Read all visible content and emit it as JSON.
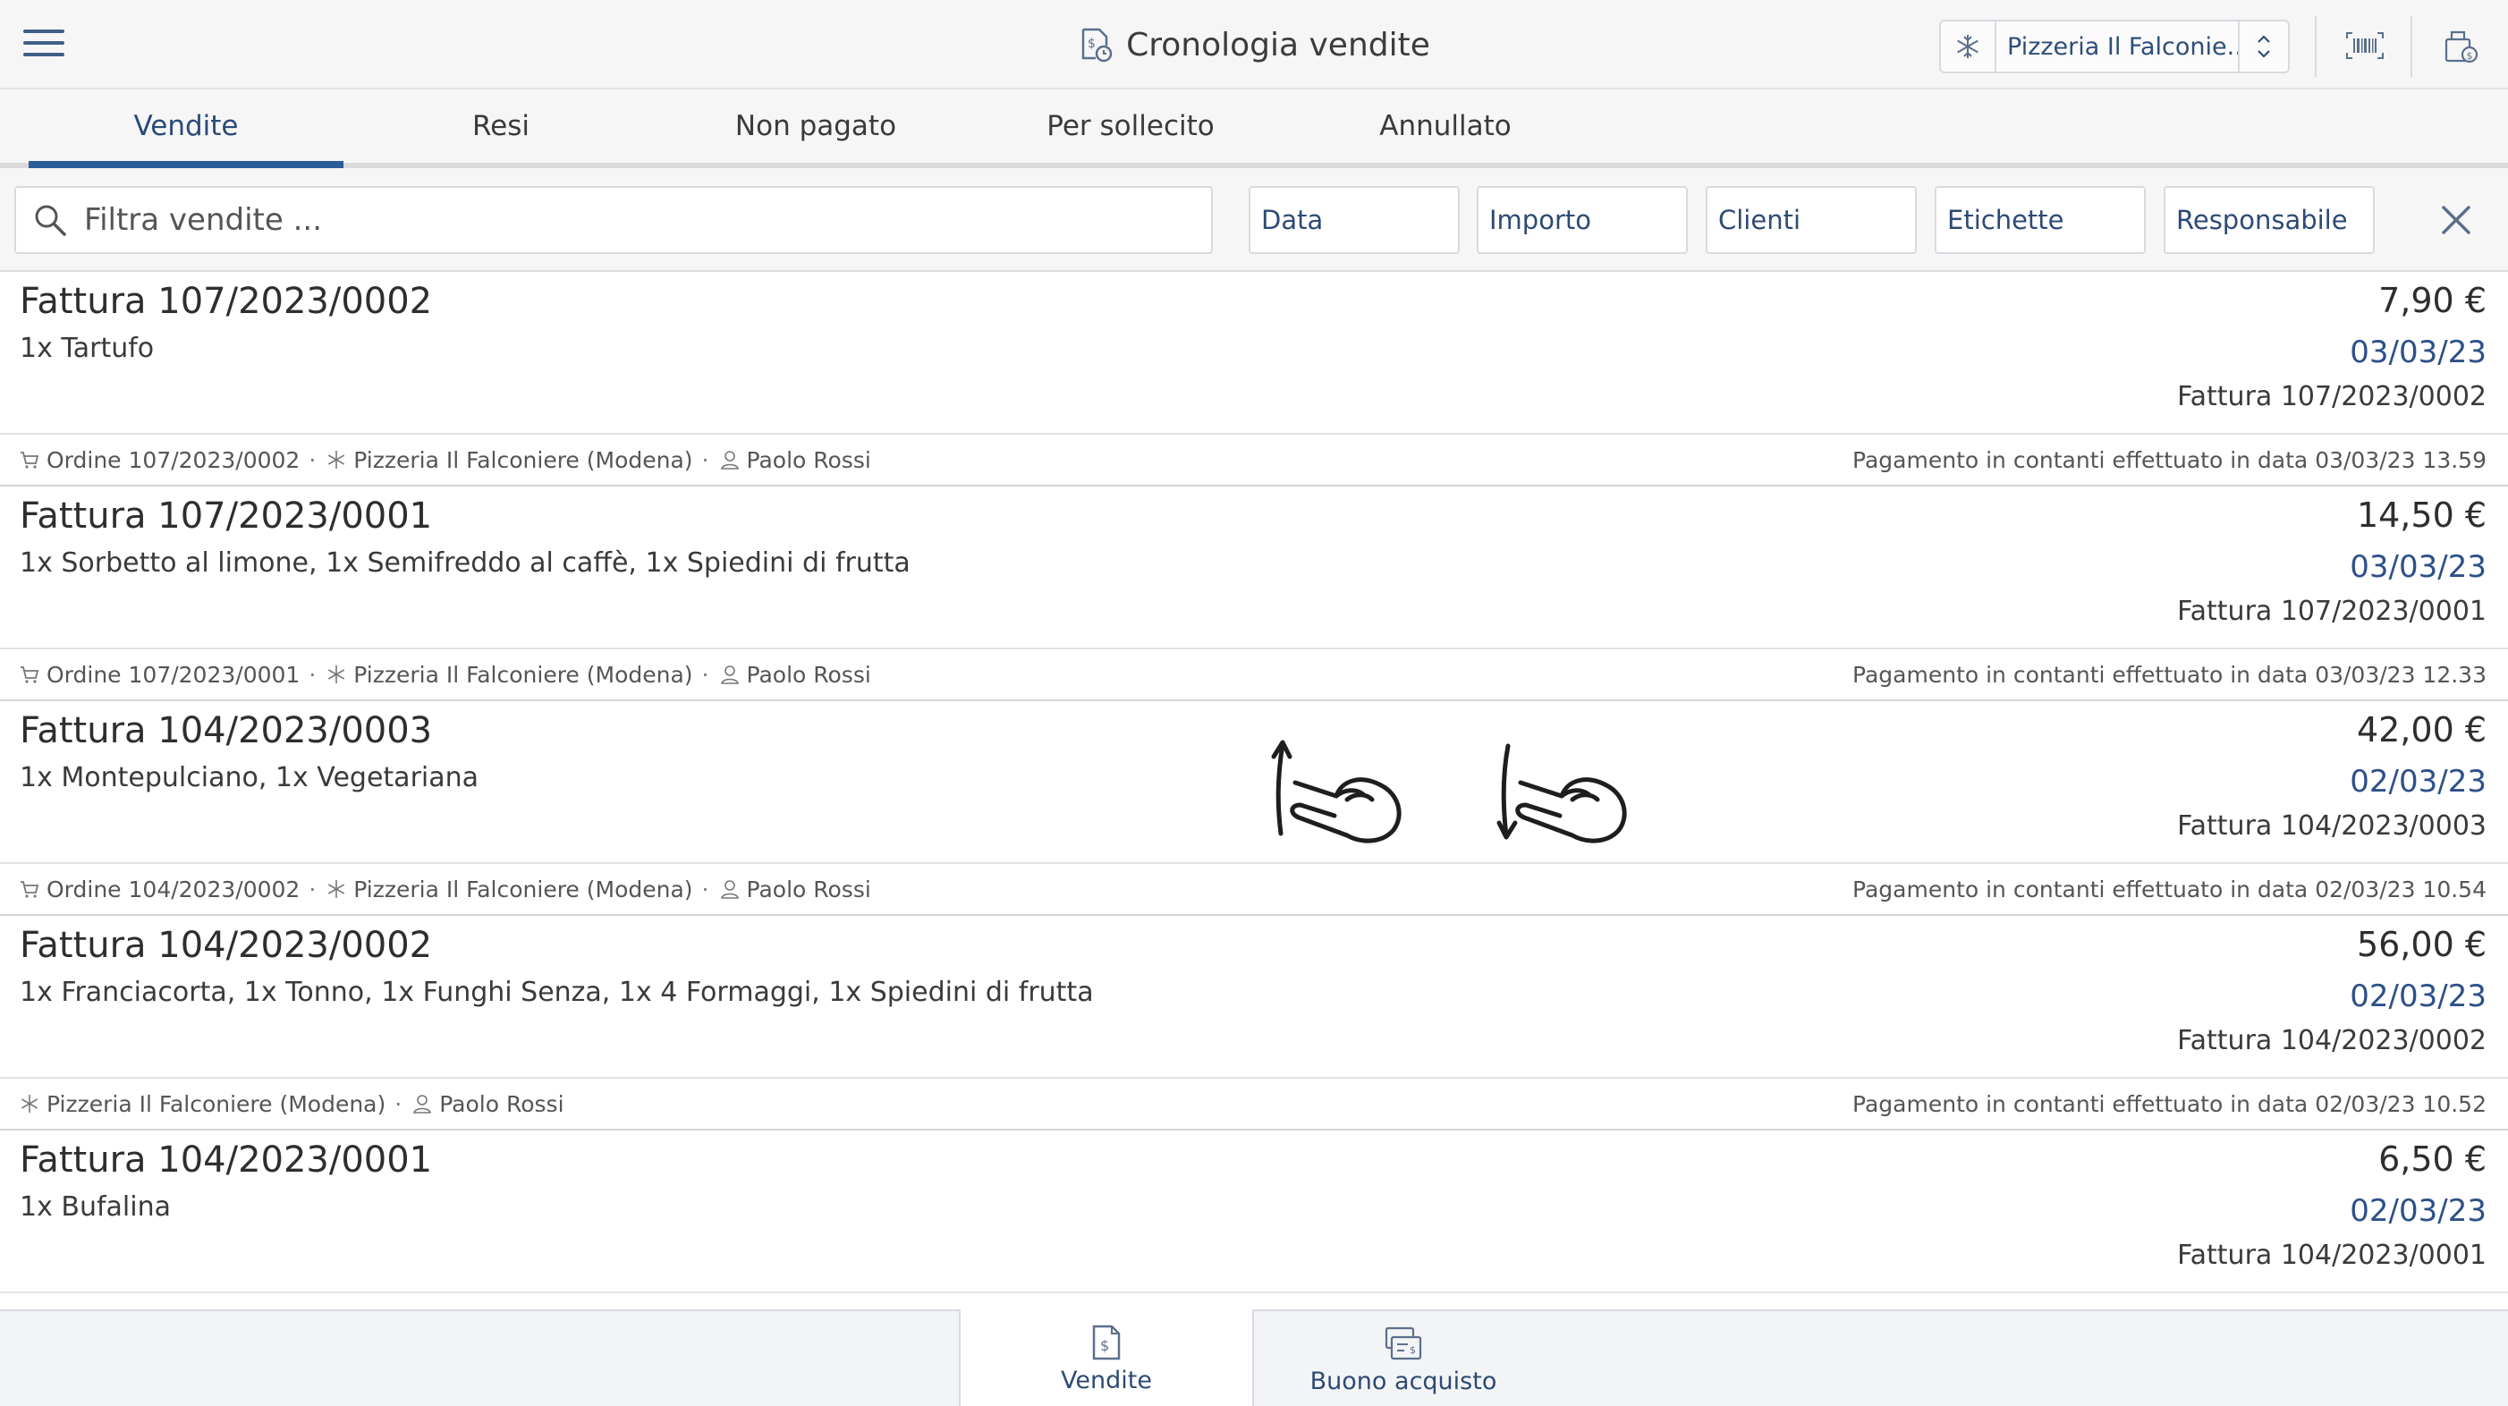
{
  "header": {
    "title": "Cronologia vendite",
    "store_selector": "Pizzeria Il Falconie..."
  },
  "tabs": [
    {
      "label": "Vendite",
      "active": true
    },
    {
      "label": "Resi"
    },
    {
      "label": "Non pagato"
    },
    {
      "label": "Per sollecito"
    },
    {
      "label": "Annullato"
    }
  ],
  "filters": {
    "search_placeholder": "Filtra vendite ...",
    "buttons": [
      "Data",
      "Importo",
      "Clienti",
      "Etichette",
      "Responsabile"
    ]
  },
  "sales": [
    {
      "invoice": "Fattura 107/2023/0002",
      "products": "1x Tartufo",
      "amount": "7,90 €",
      "date": "03/03/23",
      "reference": "Fattura 107/2023/0002",
      "order": "Ordine 107/2023/0002",
      "store": "Pizzeria Il Falconiere (Modena)",
      "user": "Paolo Rossi",
      "payment": "Pagamento in contanti effettuato in data 03/03/23 13.59"
    },
    {
      "invoice": "Fattura 107/2023/0001",
      "products": "1x Sorbetto al limone, 1x Semifreddo al caffè, 1x Spiedini di frutta",
      "amount": "14,50 €",
      "date": "03/03/23",
      "reference": "Fattura 107/2023/0001",
      "order": "Ordine 107/2023/0001",
      "store": "Pizzeria Il Falconiere (Modena)",
      "user": "Paolo Rossi",
      "payment": "Pagamento in contanti effettuato in data 03/03/23 12.33"
    },
    {
      "invoice": "Fattura 104/2023/0003",
      "products": "1x Montepulciano, 1x Vegetariana",
      "amount": "42,00 €",
      "date": "02/03/23",
      "reference": "Fattura 104/2023/0003",
      "order": "Ordine 104/2023/0002",
      "store": "Pizzeria Il Falconiere (Modena)",
      "user": "Paolo Rossi",
      "payment": "Pagamento in contanti effettuato in data 02/03/23 10.54"
    },
    {
      "invoice": "Fattura 104/2023/0002",
      "products": "1x Franciacorta, 1x Tonno, 1x Funghi Senza, 1x 4 Formaggi, 1x Spiedini di frutta",
      "amount": "56,00 €",
      "date": "02/03/23",
      "reference": "Fattura 104/2023/0002",
      "store": "Pizzeria Il Falconiere (Modena)",
      "user": "Paolo Rossi",
      "payment": "Pagamento in contanti effettuato in data 02/03/23 10.52"
    },
    {
      "invoice": "Fattura 104/2023/0001",
      "products": "1x Bufalina",
      "amount": "6,50 €",
      "date": "02/03/23",
      "reference": "Fattura 104/2023/0001"
    }
  ],
  "bottom_nav": [
    {
      "label": "Vendite",
      "icon": "receipt-dollar-icon",
      "active": true
    },
    {
      "label": "Buono acquisto",
      "icon": "voucher-icon"
    }
  ],
  "colors": {
    "accent": "#2d5c9a",
    "link_text": "#2d5088",
    "background": "#f6f6f6"
  }
}
